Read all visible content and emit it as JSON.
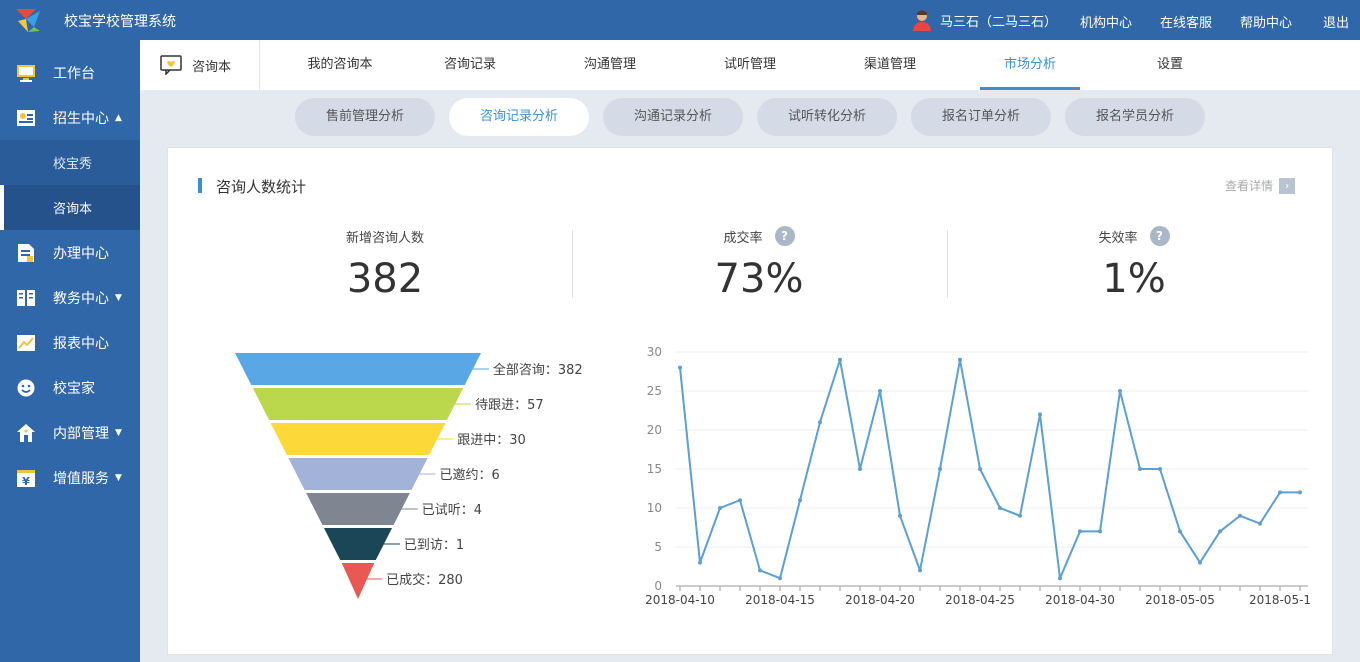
{
  "app": {
    "title": "校宝学校管理系统"
  },
  "topbar": {
    "user": "马三石（二马三石）",
    "links": [
      "机构中心",
      "在线客服",
      "帮助中心",
      "退出"
    ]
  },
  "sidebar": {
    "items": [
      {
        "label": "工作台"
      },
      {
        "label": "招生中心"
      },
      {
        "label": "校宝秀"
      },
      {
        "label": "咨询本"
      },
      {
        "label": "办理中心"
      },
      {
        "label": "教务中心"
      },
      {
        "label": "报表中心"
      },
      {
        "label": "校宝家"
      },
      {
        "label": "内部管理"
      },
      {
        "label": "增值服务"
      }
    ]
  },
  "tabs": {
    "brand": "咨询本",
    "items": [
      "我的咨询本",
      "咨询记录",
      "沟通管理",
      "试听管理",
      "渠道管理",
      "市场分析",
      "设置"
    ],
    "active": "市场分析"
  },
  "subtabs": {
    "items": [
      "售前管理分析",
      "咨询记录分析",
      "沟通记录分析",
      "试听转化分析",
      "报名订单分析",
      "报名学员分析"
    ],
    "active": "咨询记录分析"
  },
  "card": {
    "title": "咨询人数统计",
    "detail_link": "查看详情",
    "stats": [
      {
        "label": "新增咨询人数",
        "value": "382"
      },
      {
        "label": "成交率",
        "value": "73%"
      },
      {
        "label": "失效率",
        "value": "1%"
      }
    ],
    "help_glyph": "?"
  },
  "funnel": {
    "stages": [
      {
        "label": "全部咨询：382",
        "color": "#5aa7e6"
      },
      {
        "label": "待跟进：57",
        "color": "#bbd84c"
      },
      {
        "label": "跟进中：30",
        "color": "#fcd939"
      },
      {
        "label": "已邀约：6",
        "color": "#a3b2d8"
      },
      {
        "label": "已试听：4",
        "color": "#7f8692"
      },
      {
        "label": "已到访：1",
        "color": "#1b4658"
      },
      {
        "label": "已成交：280",
        "color": "#e95852"
      }
    ]
  },
  "chart_data": {
    "type": "line",
    "x": [
      "2018-04-10",
      "2018-04-11",
      "2018-04-12",
      "2018-04-13",
      "2018-04-14",
      "2018-04-15",
      "2018-04-16",
      "2018-04-17",
      "2018-04-18",
      "2018-04-19",
      "2018-04-20",
      "2018-04-21",
      "2018-04-22",
      "2018-04-23",
      "2018-04-24",
      "2018-04-25",
      "2018-04-26",
      "2018-04-27",
      "2018-04-28",
      "2018-04-29",
      "2018-04-30",
      "2018-05-01",
      "2018-05-02",
      "2018-05-03",
      "2018-05-04",
      "2018-05-05",
      "2018-05-06",
      "2018-05-07",
      "2018-05-08",
      "2018-05-09",
      "2018-05-10",
      "2018-05-11"
    ],
    "tick_labels": [
      "2018-04-10",
      "2018-04-15",
      "2018-04-20",
      "2018-04-25",
      "2018-04-30",
      "2018-05-05",
      "2018-05-1"
    ],
    "series": [
      {
        "values": [
          28,
          3,
          10,
          11,
          2,
          1,
          11,
          21,
          29,
          15,
          25,
          9,
          2,
          15,
          29,
          15,
          10,
          9,
          22,
          1,
          7,
          7,
          25,
          15,
          15,
          7,
          3,
          7,
          9,
          8,
          12,
          12
        ]
      }
    ],
    "ylim": [
      0,
      30
    ],
    "yticks": [
      0,
      5,
      10,
      15,
      20,
      25,
      30
    ],
    "color": "#5b9fd6",
    "grid": true
  }
}
